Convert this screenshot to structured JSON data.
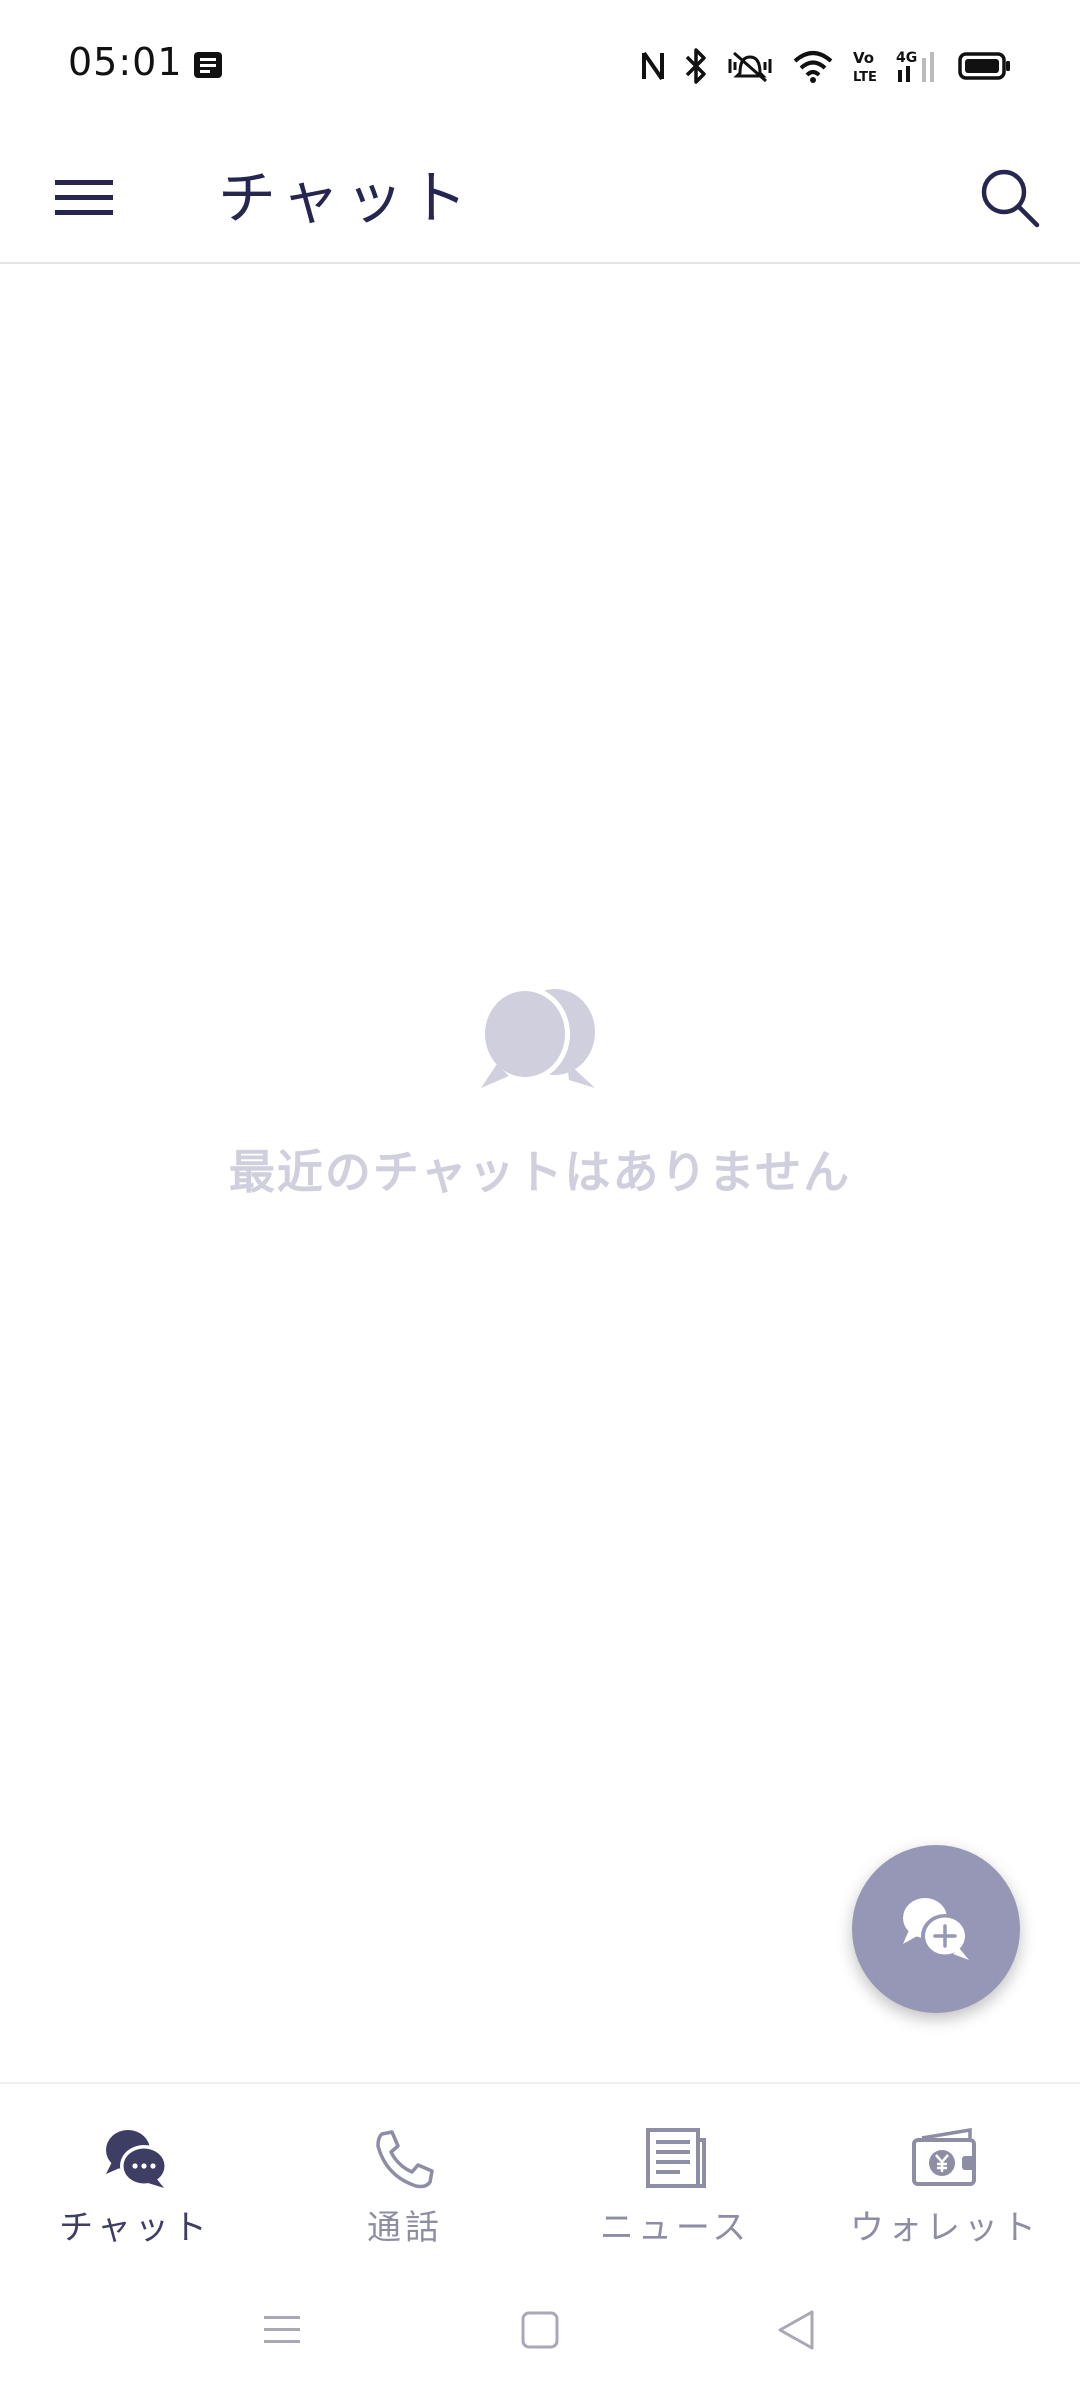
{
  "status_bar": {
    "time": "05:01"
  },
  "header": {
    "title": "チャット"
  },
  "empty_state": {
    "message": "最近のチャットはありません"
  },
  "bottom_nav": {
    "items": [
      {
        "label": "チャット",
        "icon": "chat-bubbles-icon",
        "active": true
      },
      {
        "label": "通話",
        "icon": "phone-icon",
        "active": false
      },
      {
        "label": "ニュース",
        "icon": "newspaper-icon",
        "active": false
      },
      {
        "label": "ウォレット",
        "icon": "wallet-yen-icon",
        "active": false
      }
    ]
  },
  "colors": {
    "title": "#262651",
    "empty_text": "#cfcfdd",
    "fab": "#9696b6",
    "nav_active": "#3e3e64",
    "nav_inactive": "#8d8da5"
  }
}
